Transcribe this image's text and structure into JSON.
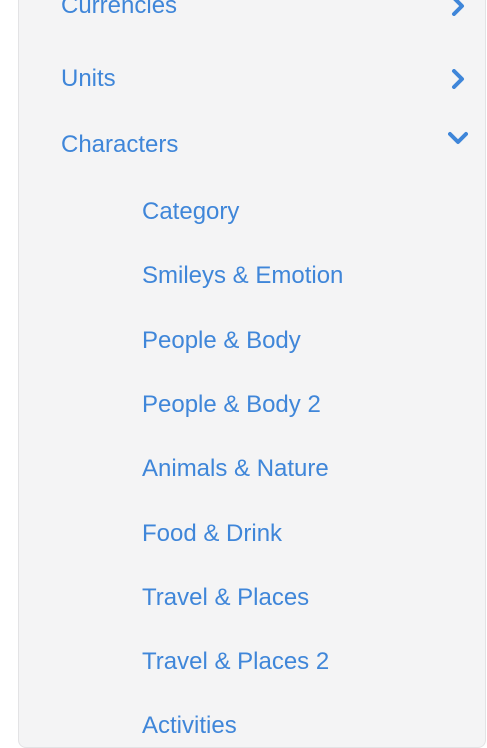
{
  "sections": [
    {
      "label": "Currencies",
      "chevron": "chevron-right-icon"
    },
    {
      "label": "Units",
      "chevron": "chevron-right-icon"
    },
    {
      "label": "Characters",
      "chevron": "chevron-down-icon"
    }
  ],
  "characters": {
    "items": [
      "Category",
      "Smileys & Emotion",
      "People & Body",
      "People & Body 2",
      "Animals & Nature",
      "Food & Drink",
      "Travel & Places",
      "Travel & Places 2",
      "Activities"
    ]
  },
  "colors": {
    "accent": "#3f86d9",
    "panel_bg": "#f4f4f5",
    "panel_border": "#e3e3e5"
  }
}
